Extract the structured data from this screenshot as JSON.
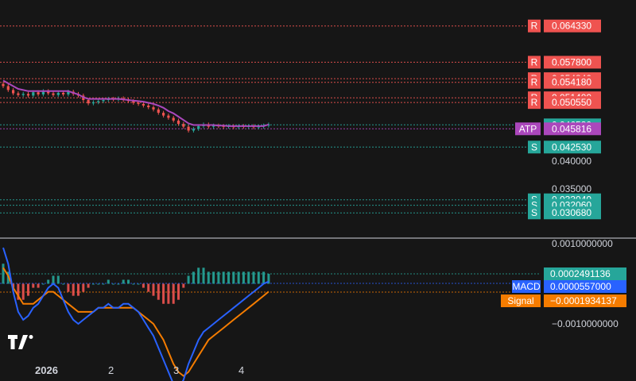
{
  "chart_data": [
    {
      "type": "candlestick",
      "pane": "price",
      "price_levels": [
        {
          "tag": "R",
          "value": "0.064330",
          "color": "#ef5350"
        },
        {
          "tag": "R",
          "value": "0.057800",
          "color": "#ef5350"
        },
        {
          "tag": "R",
          "value": "0.054840",
          "color": "#ef5350"
        },
        {
          "tag": "R",
          "value": "0.054180",
          "color": "#ef5350"
        },
        {
          "tag": "R",
          "value": "0.051400",
          "color": "#ef5350"
        },
        {
          "tag": "R",
          "value": "0.050550",
          "color": "#ef5350"
        },
        {
          "tag": "",
          "value": "0.046530",
          "color": "#26a69a"
        },
        {
          "tag": "ATP",
          "value": "0.045816",
          "color": "#ab47bc"
        },
        {
          "tag": "S",
          "value": "0.042530",
          "color": "#26a69a"
        },
        {
          "tag": "S",
          "value": "0.033040",
          "color": "#26a69a"
        },
        {
          "tag": "S",
          "value": "0.032060",
          "color": "#26a69a"
        },
        {
          "tag": "S",
          "value": "0.030680",
          "color": "#26a69a"
        }
      ],
      "y_ticks": [
        "0.040000",
        "0.035000"
      ],
      "close": [
        0.0535,
        0.0528,
        0.0522,
        0.0519,
        0.0521,
        0.0518,
        0.0524,
        0.052,
        0.0526,
        0.0522,
        0.0519,
        0.0523,
        0.052,
        0.0525,
        0.0521,
        0.0518,
        0.051,
        0.0504,
        0.0506,
        0.0508,
        0.051,
        0.0512,
        0.0511,
        0.0513,
        0.051,
        0.0508,
        0.0505,
        0.0503,
        0.05,
        0.0497,
        0.0493,
        0.0487,
        0.0482,
        0.0478,
        0.0473,
        0.0467,
        0.0462,
        0.0455,
        0.0458,
        0.0463,
        0.0466,
        0.0462,
        0.0464,
        0.0463,
        0.0462,
        0.0463,
        0.0461,
        0.0463,
        0.0462,
        0.0463,
        0.0461,
        0.0462,
        0.0464,
        0.0466
      ],
      "atp_line": [
        0.0545,
        0.054,
        0.0535,
        0.053,
        0.0528,
        0.0526,
        0.0526,
        0.0526,
        0.0526,
        0.0526,
        0.0526,
        0.0526,
        0.0526,
        0.0526,
        0.0523,
        0.052,
        0.0515,
        0.0512,
        0.0512,
        0.0512,
        0.0512,
        0.0512,
        0.0512,
        0.0512,
        0.0511,
        0.051,
        0.0509,
        0.0508,
        0.0507,
        0.0505,
        0.0503,
        0.05,
        0.0496,
        0.049,
        0.0486,
        0.048,
        0.0474,
        0.0468,
        0.0465,
        0.0465,
        0.0465,
        0.0465,
        0.0465,
        0.0464,
        0.0464,
        0.0463,
        0.0463,
        0.0463,
        0.0463,
        0.0463,
        0.0463,
        0.0463,
        0.0463,
        0.0466
      ],
      "x_labels": [
        "2026",
        "2",
        "3",
        "4"
      ]
    },
    {
      "type": "macd",
      "pane": "macd",
      "labels": [
        {
          "name": "",
          "value": "0.0002491136",
          "color": "#26a69a"
        },
        {
          "name": "MACD",
          "value": "0.0000557000",
          "color": "#2962ff"
        },
        {
          "name": "Signal",
          "value": "−0.0001934137",
          "color": "#f57c00"
        }
      ],
      "y_ticks": [
        "0.0010000000",
        "−0.0010000000"
      ],
      "macd": [
        0.0009,
        0.0005,
        -0.0002,
        -0.0007,
        -0.0009,
        -0.0008,
        -0.0006,
        -0.0005,
        -0.0003,
        -0.0001,
        0.0,
        -0.0001,
        -0.0004,
        -0.0007,
        -0.0009,
        -0.001,
        -0.0009,
        -0.0008,
        -0.0007,
        -0.0006,
        -0.0006,
        -0.0005,
        -0.0006,
        -0.0006,
        -0.0005,
        -0.0005,
        -0.0006,
        -0.0007,
        -0.0009,
        -0.0011,
        -0.0013,
        -0.0016,
        -0.0019,
        -0.0022,
        -0.0025,
        -0.0026,
        -0.0024,
        -0.002,
        -0.0017,
        -0.0014,
        -0.0012,
        -0.0011,
        -0.001,
        -0.0009,
        -0.0008,
        -0.0007,
        -0.0006,
        -0.0005,
        -0.0004,
        -0.0003,
        -0.0002,
        -0.0001,
        0.0,
        5.57e-05
      ],
      "signal": [
        0.0004,
        0.0002,
        -0.0001,
        -0.0003,
        -0.0005,
        -0.0005,
        -0.0005,
        -0.0004,
        -0.0003,
        -0.0002,
        -0.0002,
        -0.0003,
        -0.0004,
        -0.0005,
        -0.0006,
        -0.0007,
        -0.0007,
        -0.0007,
        -0.0007,
        -0.0006,
        -0.0006,
        -0.0006,
        -0.0006,
        -0.0006,
        -0.0006,
        -0.0006,
        -0.0006,
        -0.0007,
        -0.0008,
        -0.0009,
        -0.001,
        -0.0012,
        -0.0014,
        -0.0017,
        -0.002,
        -0.0022,
        -0.0023,
        -0.0022,
        -0.002,
        -0.0018,
        -0.0016,
        -0.0014,
        -0.0013,
        -0.0012,
        -0.0011,
        -0.001,
        -0.0009,
        -0.0008,
        -0.0007,
        -0.0006,
        -0.0005,
        -0.0004,
        -0.0003,
        -0.0001934137
      ]
    }
  ],
  "brand": {
    "logo": "TV"
  }
}
